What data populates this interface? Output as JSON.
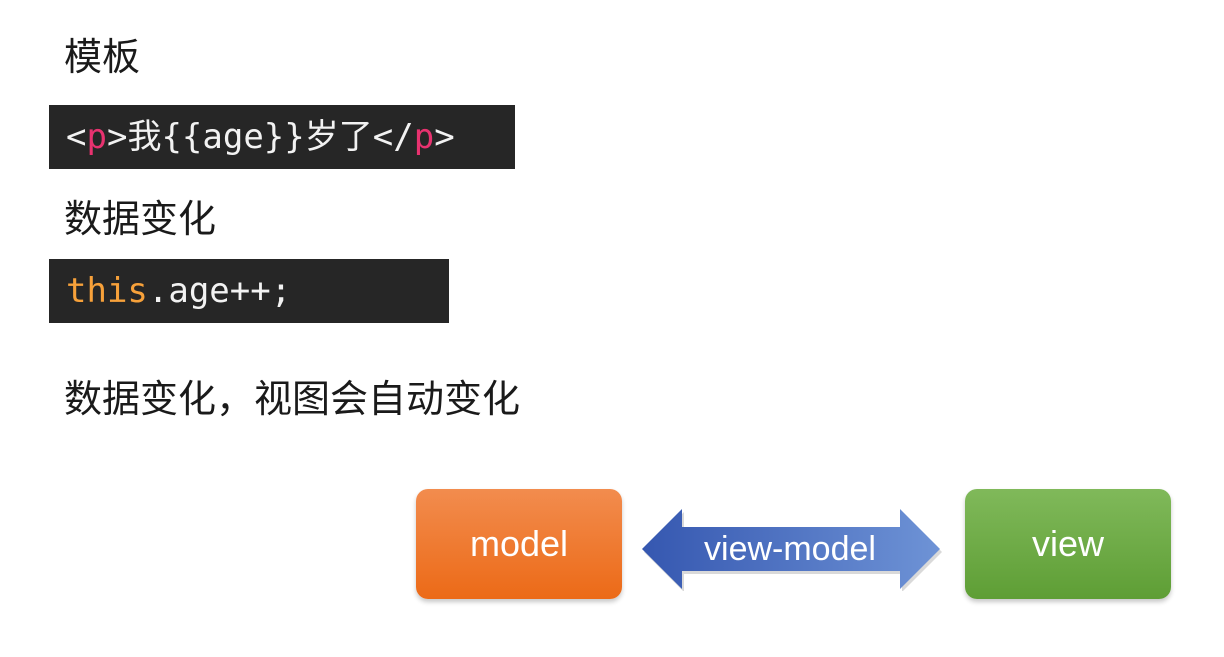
{
  "sections": {
    "template_heading": "模板",
    "data_change_heading": "数据变化",
    "summary": "数据变化，视图会自动变化"
  },
  "code": {
    "template": {
      "lt1": "<",
      "tag1": "p",
      "gt1": ">",
      "text": "我{{age}}岁了",
      "lt2": "</",
      "tag2": "p",
      "gt2": ">"
    },
    "data_change": {
      "keyword": "this",
      "rest": ".age++;"
    }
  },
  "diagram": {
    "model_label": "model",
    "viewmodel_label": "view-model",
    "view_label": "view",
    "colors": {
      "model": "#ec6a17",
      "viewmodel": "#3f66bd",
      "view": "#5e9e35"
    }
  }
}
